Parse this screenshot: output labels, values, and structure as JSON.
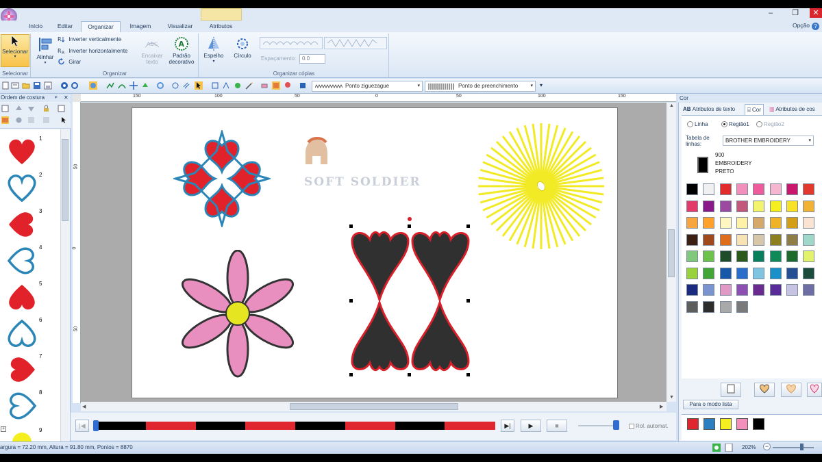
{
  "ribbon": {
    "tabs": [
      "Início",
      "Editar",
      "Organizar",
      "Imagem",
      "Visualizar",
      "Atributos"
    ],
    "active_tab": "Organizar",
    "options_label": "Opção",
    "groups": {
      "select": {
        "label": "Selecionar",
        "button": "Selecionar"
      },
      "arrange": {
        "label": "Organizar",
        "align": "Alinhar",
        "flip_vertical": "Inverter verticalmente",
        "flip_horizontal": "Inverter horizontalmente",
        "rotate": "Girar",
        "fit_text_line1": "Encaixar",
        "fit_text_line2": "texto",
        "pattern_line1": "Padrão",
        "pattern_line2": "decorativo"
      },
      "copies": {
        "label": "Organizar cópias",
        "mirror": "Espelho",
        "circle": "Círculo",
        "spacing_label": "Espaçamento:",
        "spacing_value": "0.0"
      }
    }
  },
  "toolbar": {
    "line_stitch": "Ponto ziguezague",
    "fill_stitch": "Ponto de preenchimento"
  },
  "left_panel": {
    "title": "Ordem de costura",
    "items": [
      {
        "num": "1",
        "shape": "heart-filled"
      },
      {
        "num": "2",
        "shape": "heart-outline"
      },
      {
        "num": "3",
        "shape": "heart-filled-right"
      },
      {
        "num": "4",
        "shape": "heart-outline-right"
      },
      {
        "num": "5",
        "shape": "heart-filled"
      },
      {
        "num": "6",
        "shape": "heart-outline"
      },
      {
        "num": "7",
        "shape": "heart-filled-right"
      },
      {
        "num": "8",
        "shape": "heart-outline-right"
      },
      {
        "num": "9",
        "shape": "sun"
      }
    ]
  },
  "rulers": {
    "h": [
      "150",
      "100",
      "50",
      "0",
      "50",
      "100",
      "150"
    ],
    "v": [
      "50",
      "0",
      "50"
    ]
  },
  "canvas": {
    "watermark": "SOFT SOLDIER"
  },
  "playback": {
    "auto_scroll": "Rol. automat.",
    "progress_segments": [
      "#000000",
      "#e0262f",
      "#000000",
      "#e0262f",
      "#000000",
      "#e0262f",
      "#000000",
      "#e0262f"
    ]
  },
  "right_panel": {
    "title": "Cor",
    "tabs": [
      "Atributos de texto",
      "Cor",
      "Atributos de cos"
    ],
    "active_tab": "Cor",
    "radios": {
      "line": "Linha",
      "region1": "Região1",
      "region2": "Região2",
      "selected": "Região1"
    },
    "thread_table_label": "Tabela de linhas:",
    "thread_table_value": "BROTHER EMBROIDERY",
    "current_color": {
      "code": "900",
      "brand": "EMBROIDERY",
      "name": "PRETO",
      "hex": "#000000"
    },
    "palette": [
      "#000000",
      "#f0f0f0",
      "#e22b2b",
      "#f28fbb",
      "#ed5b9b",
      "#f6b6cf",
      "#c9176b",
      "#e2392c",
      "#e23b6a",
      "#8a1a8a",
      "#9c4aa0",
      "#c2587a",
      "#f3f36d",
      "#f5ef1f",
      "#f7e229",
      "#f2b236",
      "#f7a53c",
      "#ffa12a",
      "#fff6c0",
      "#fff2a6",
      "#d6a96a",
      "#eeb327",
      "#d29f17",
      "#fbe3d1",
      "#3b1f12",
      "#a0491c",
      "#de6e1c",
      "#f7e3b3",
      "#d8c6a8",
      "#8e7f1f",
      "#8f7d46",
      "#9fd7c8",
      "#80c87b",
      "#6cc24a",
      "#1f4d2a",
      "#2b5a1c",
      "#087f5b",
      "#0e8a57",
      "#1d6a2b",
      "#e2f26a",
      "#9ad23c",
      "#43a534",
      "#1858a8",
      "#2c6fcb",
      "#7fc4e0",
      "#1a90c9",
      "#264e93",
      "#1b4b3a",
      "#1b2b80",
      "#7a94d0",
      "#e19ac6",
      "#8d4fb1",
      "#6a2a8f",
      "#5a2c99",
      "#c7c3e2",
      "#6e6ea5",
      "#5d5d5d",
      "#2d2d2d",
      "#a9a9a9",
      "#7a7a7a"
    ],
    "list_mode_button": "Para o modo lista",
    "used_colors": [
      "#e0262f",
      "#2b7fc0",
      "#f5ef1f",
      "#f28fbb",
      "#000000"
    ]
  },
  "status": {
    "dimensions": "argura = 72.20 mm, Altura = 91.80 mm, Pontos = 8870",
    "zoom": "202%"
  }
}
